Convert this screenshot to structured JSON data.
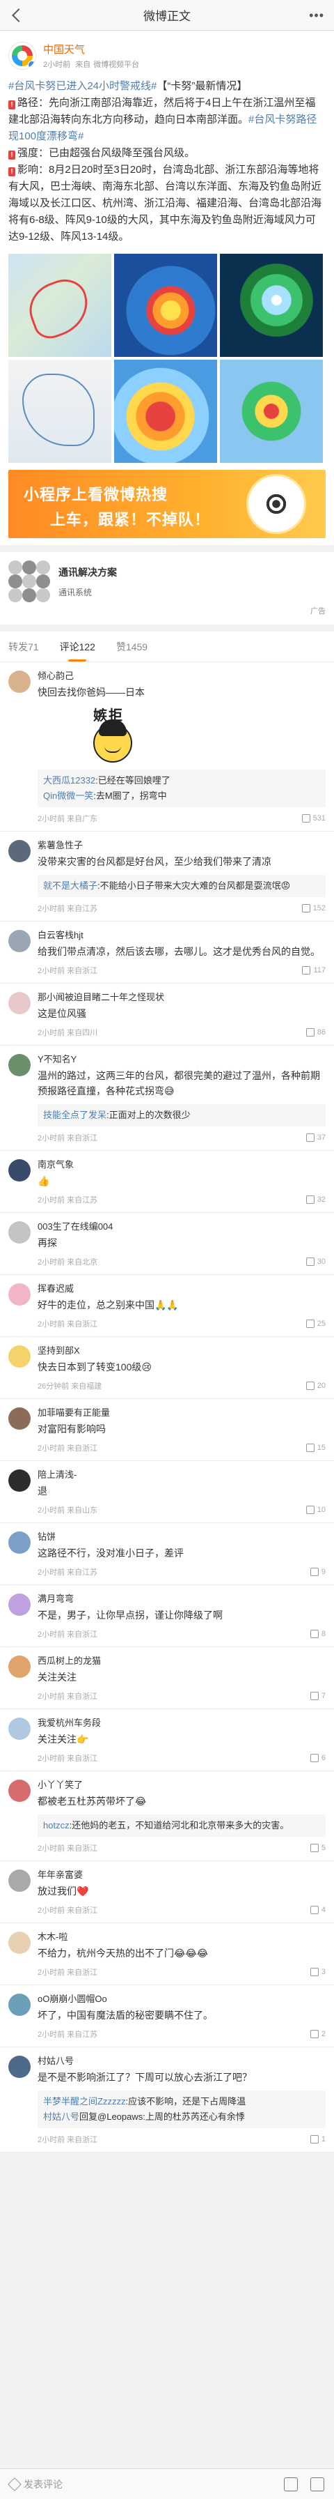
{
  "header": {
    "title": "微博正文"
  },
  "post": {
    "author": "中国天气",
    "time": "2小时前",
    "source_prefix": "来自",
    "source": "微博视频平台",
    "text_tag1": "#台风卡努已进入24小时警戒线#",
    "text_head": "【“卡努”最新情况】",
    "text_path_label": "路径：",
    "text_path": "先向浙江南部沿海靠近，然后将于4日上午在浙江温州至福建北部沿海转向东北方向移动，趋向日本南部洋面。",
    "text_tag2": "#台风卡努路径现100度漂移弯#",
    "text_strength_label": "强度：",
    "text_strength": "已由超强台风级降至强台风级。",
    "text_impact_label": "影响：",
    "text_impact": "8月2日20时至3日20时，台湾岛北部、浙江东部沿海等地将有大风，巴士海峡、南海东北部、台湾以东洋面、东海及钓鱼岛附近海域以及长江口区、杭州湾、浙江沿海、福建沿海、台湾岛北部沿海将有6-8级、阵风9-10级的大风，其中东海及钓鱼岛附近海域风力可达9-12级、阵风13-14级。",
    "banner_line1": "小程序上看微博热搜",
    "banner_line2": "上车，跟紧！不掉队！"
  },
  "ad": {
    "title": "通讯解决方案",
    "subtitle": "通讯系统",
    "tag": "广告"
  },
  "tabs": [
    {
      "label": "转发71"
    },
    {
      "label": "评论122"
    },
    {
      "label": "赞1459"
    }
  ],
  "comments": [
    {
      "name": "倾心韵己",
      "text": "快回去找你爸妈——日本",
      "sticker": "嫉拒",
      "replies": [
        {
          "user": "大西瓜12332",
          "text": ":已经在等回娘哩了"
        },
        {
          "user": "Qin微微一笑",
          "text": ":去M圈了，拐弯中"
        }
      ],
      "time": "2小时前 来自广东",
      "likes": "531"
    },
    {
      "name": "紫薯急性子",
      "text": "没带来灾害的台风都是好台风，至少给我们带来了清凉",
      "replies": [
        {
          "user": "就不是大橘子",
          "text": ":不能给小日子带来大灾大难的台风都是耍流氓😡"
        }
      ],
      "time": "2小时前 来自江苏",
      "likes": "152"
    },
    {
      "name": "白云客栈hjt",
      "text": "给我们带点清凉，然后该去哪，去哪儿。这才是优秀台风的自觉。",
      "time": "2小时前 来自浙江",
      "likes": "117"
    },
    {
      "name": "那小闻被迫目睹二十年之怪现状",
      "text": "这是位风骚",
      "time": "2小时前 来自四川",
      "likes": "86"
    },
    {
      "name": "Y不知名Y",
      "text": "温州的路过，这两三年的台风，都很完美的避过了温州，各种前期预报路径直撞，各种花式拐弯😅",
      "replies": [
        {
          "user": "技能全点了发呆",
          "text": ":正面对上的次数很少"
        }
      ],
      "time": "2小时前 来自浙江",
      "likes": "37"
    },
    {
      "name": "南京气象",
      "text": "👍",
      "time": "2小时前 来自江苏",
      "likes": "32"
    },
    {
      "name": "003生了在线编004",
      "text": "再探",
      "time": "2小时前 来自北京",
      "likes": "30"
    },
    {
      "name": "挥春迟威",
      "text": "好牛的走位，总之别来中国🙏🙏",
      "time": "2小时前 来自浙江",
      "likes": "25"
    },
    {
      "name": "坚持到部X",
      "text": "快去日本到了转变100级😢",
      "time": "26分钟前 来自福建",
      "likes": "20"
    },
    {
      "name": "加菲喵要有正能量",
      "text": "对富阳有影响吗",
      "time": "2小时前 来自浙江",
      "likes": "15"
    },
    {
      "name": "陪上清浅-",
      "text": "退",
      "time": "2小时前 来自山东",
      "likes": "10"
    },
    {
      "name": "钻饼",
      "text": "这路径不行，没对准小日子，差评",
      "time": "2小时前 来自江苏",
      "likes": "9"
    },
    {
      "name": "满月弯弯",
      "text": "不是，男子，让你早点拐，谨让你降级了啊",
      "time": "2小时前 来自浙江",
      "likes": "8"
    },
    {
      "name": "西瓜树上的龙猫",
      "text": "关注关注",
      "time": "2小时前 来自浙江",
      "likes": "7"
    },
    {
      "name": "我爱杭州车务段",
      "text": "关注关注👉",
      "time": "2小时前 来自浙江",
      "likes": "6"
    },
    {
      "name": "小丫丫笑了",
      "text": "都被老五杜苏芮带坏了😂",
      "replies": [
        {
          "user": "hotzcz",
          "text": ":还他妈的老五，不知道给河北和北京带来多大的灾害。"
        }
      ],
      "time": "2小时前 来自浙江",
      "likes": "5"
    },
    {
      "name": "年年亲富婆",
      "text": "放过我们❤️",
      "time": "2小时前 来自浙江",
      "likes": "4"
    },
    {
      "name": "木木-啦",
      "text": "不给力，杭州今天热的出不了门😂😂😂",
      "time": "2小时前 来自浙江",
      "likes": "3"
    },
    {
      "name": "oO崩崩小圆帽Oo",
      "text": "坏了，中国有魔法盾的秘密要瞒不住了。",
      "time": "2小时前 来自江苏",
      "likes": "2"
    },
    {
      "name": "村姑八号",
      "text": "是不是不影响浙江了？下周可以放心去浙江了吧？",
      "replies": [
        {
          "user": "半梦半醒之间Zzzzzz",
          "text": ":应该不影响，还是下占周降温"
        },
        {
          "user": "村姑八号",
          "text": "回复@Leopaws:上周的杜苏芮还心有余悸"
        }
      ],
      "time": "2小时前 来自浙江",
      "likes": "1"
    }
  ],
  "bottom": {
    "placeholder": "发表评论"
  }
}
